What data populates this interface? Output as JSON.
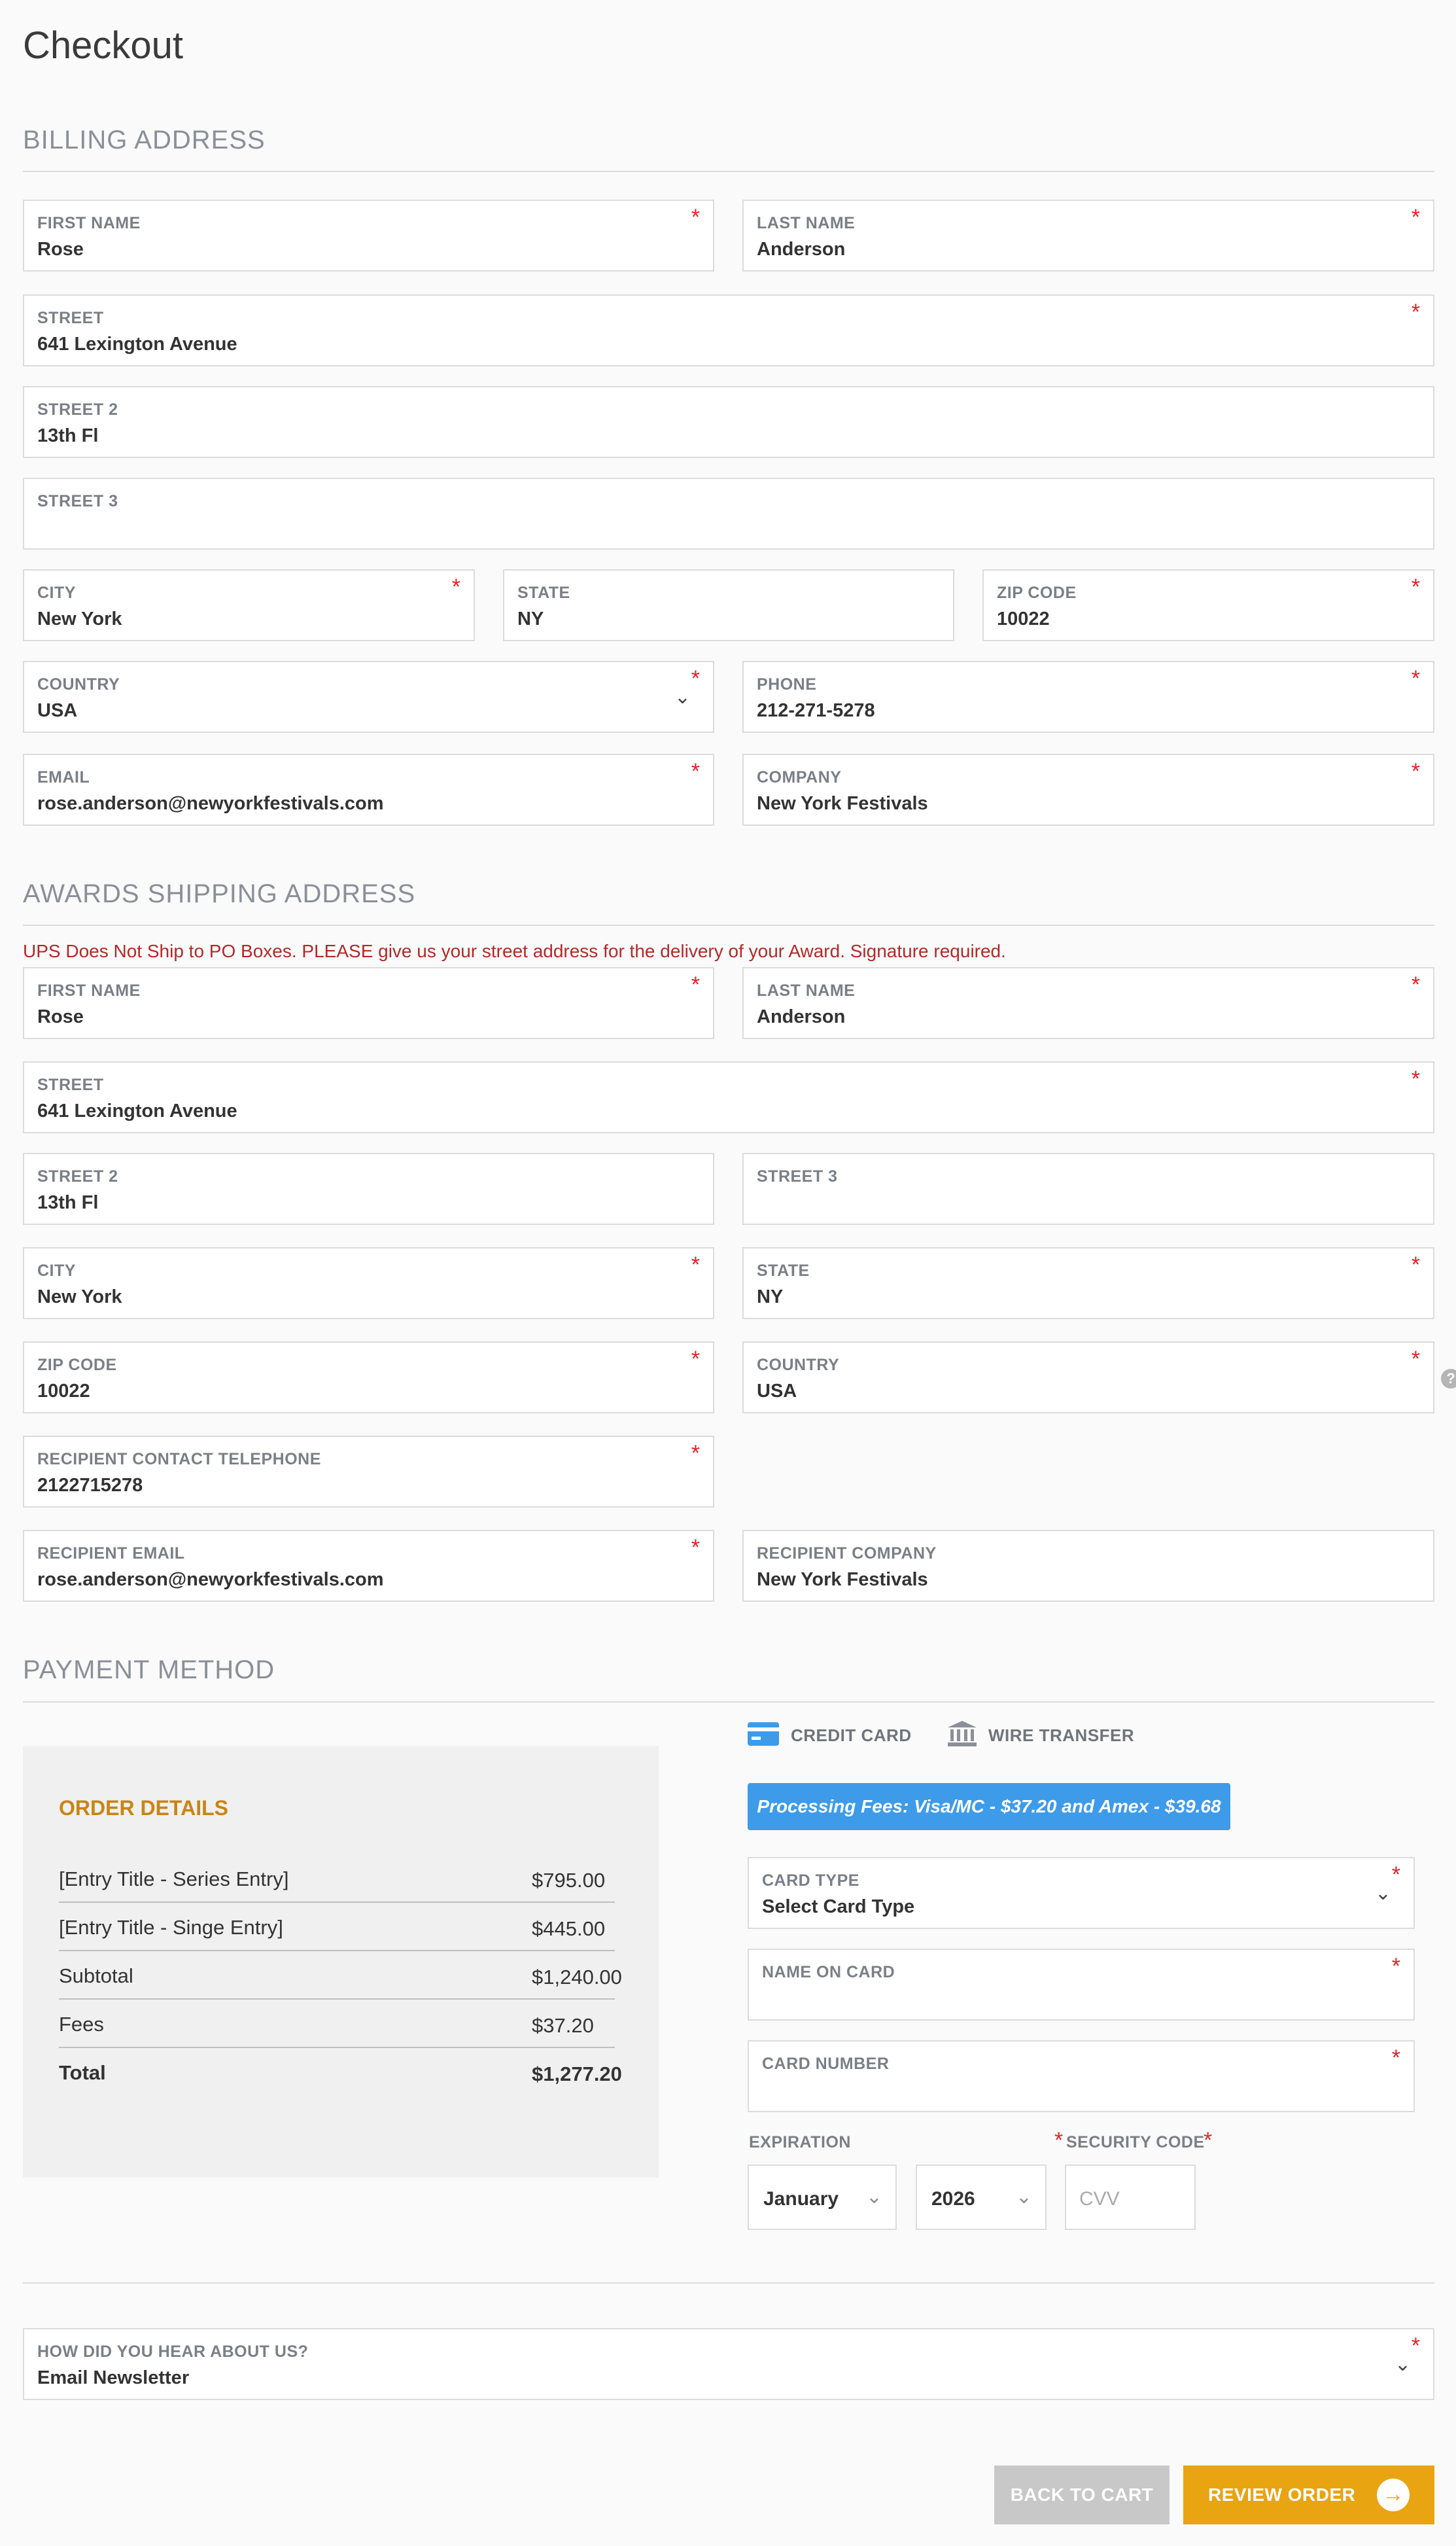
{
  "page": {
    "title": "Checkout"
  },
  "billing": {
    "section_title": "BILLING ADDRESS",
    "first_name": {
      "label": "FIRST NAME",
      "value": "Rose"
    },
    "last_name": {
      "label": "LAST NAME",
      "value": "Anderson"
    },
    "street": {
      "label": "STREET",
      "value": "641 Lexington Avenue"
    },
    "street2": {
      "label": "STREET 2",
      "value": "13th Fl"
    },
    "street3": {
      "label": "STREET 3",
      "value": ""
    },
    "city": {
      "label": "CITY",
      "value": "New York"
    },
    "state": {
      "label": "STATE",
      "value": "NY"
    },
    "zip": {
      "label": "ZIP CODE",
      "value": "10022"
    },
    "country": {
      "label": "COUNTRY",
      "value": "USA"
    },
    "phone": {
      "label": "PHONE",
      "value": "212-271-5278"
    },
    "email": {
      "label": "EMAIL",
      "value": "rose.anderson@newyorkfestivals.com"
    },
    "company": {
      "label": "COMPANY",
      "value": "New York Festivals"
    }
  },
  "shipping": {
    "section_title": "AWARDS SHIPPING ADDRESS",
    "notice": "UPS Does Not Ship to PO Boxes. PLEASE give us your street address for the delivery of your Award. Signature required.",
    "first_name": {
      "label": "FIRST NAME",
      "value": "Rose"
    },
    "last_name": {
      "label": "LAST NAME",
      "value": "Anderson"
    },
    "street": {
      "label": "STREET",
      "value": "641 Lexington Avenue"
    },
    "street2": {
      "label": "STREET 2",
      "value": "13th Fl"
    },
    "street3": {
      "label": "STREET 3",
      "value": ""
    },
    "city": {
      "label": "CITY",
      "value": "New York"
    },
    "state": {
      "label": "STATE",
      "value": "NY"
    },
    "zip": {
      "label": "ZIP CODE",
      "value": "10022"
    },
    "country": {
      "label": "COUNTRY",
      "value": "USA"
    },
    "recipient_phone": {
      "label": "RECIPIENT CONTACT TELEPHONE",
      "value": "2122715278"
    },
    "recipient_email": {
      "label": "RECIPIENT EMAIL",
      "value": "rose.anderson@newyorkfestivals.com"
    },
    "recipient_company": {
      "label": "RECIPIENT COMPANY",
      "value": "New York Festivals"
    }
  },
  "payment": {
    "section_title": "PAYMENT METHOD",
    "tabs": [
      {
        "label": "CREDIT CARD",
        "icon": "credit-card-icon"
      },
      {
        "label": "WIRE TRANSFER",
        "icon": "bank-icon"
      }
    ],
    "fee_banner": "Processing Fees: Visa/MC - $37.20 and Amex - $39.68",
    "card_type": {
      "label": "CARD TYPE",
      "value": "Select Card Type"
    },
    "name_on_card": {
      "label": "NAME ON CARD",
      "value": ""
    },
    "card_number": {
      "label": "CARD NUMBER",
      "value": ""
    },
    "expiration": {
      "label": "EXPIRATION",
      "month": "January",
      "year": "2026"
    },
    "security_code": {
      "label": "SECURITY CODE",
      "placeholder": "CVV"
    }
  },
  "order": {
    "title": "ORDER DETAILS",
    "rows": [
      {
        "name": "[Entry Title - Series Entry]",
        "amount": "$795.00"
      },
      {
        "name": "[Entry Title - Singe Entry]",
        "amount": "$445.00"
      },
      {
        "name": "Subtotal",
        "amount": "$1,240.00"
      },
      {
        "name": "Fees",
        "amount": "$37.20"
      }
    ],
    "total": {
      "name": "Total",
      "amount": "$1,277.20"
    }
  },
  "referral": {
    "label": "HOW DID YOU HEAR ABOUT US?",
    "value": "Email Newsletter"
  },
  "actions": {
    "back_label": "BACK TO CART",
    "review_label": "REVIEW ORDER"
  },
  "colors": {
    "accent_blue": "#3d9be9",
    "order_title": "#c98514",
    "review_button": "#e8a411",
    "required": "#e0242a",
    "notice": "#b12a2a"
  },
  "misc": {
    "help_icon_glyph": "?"
  }
}
